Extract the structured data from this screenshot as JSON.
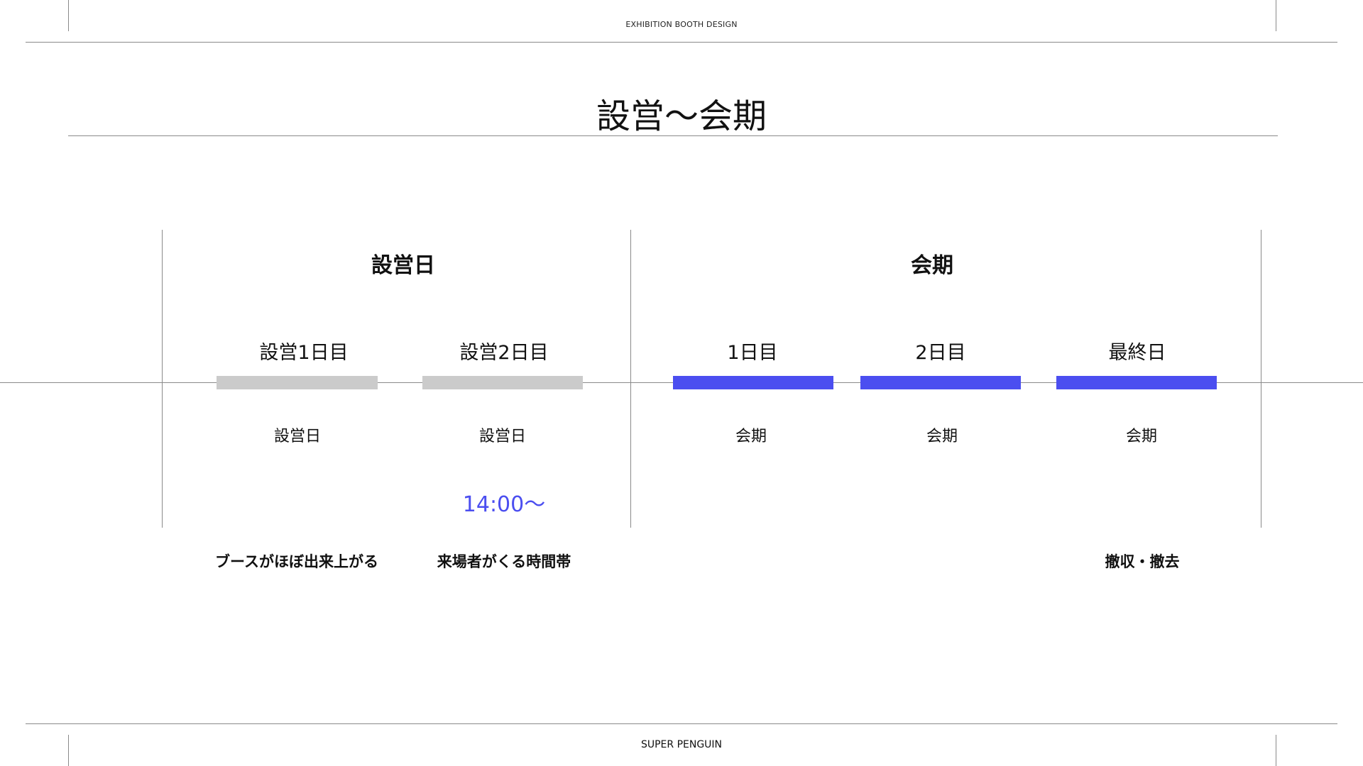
{
  "header": {
    "label": "EXHIBITION BOOTH DESIGN"
  },
  "page": {
    "title": "設営〜会期"
  },
  "footer": {
    "label": "SUPER PENGUIN"
  },
  "timeline": {
    "sections": [
      {
        "title": "設営日"
      },
      {
        "title": "会期"
      }
    ],
    "days": [
      {
        "label": "設営1日目",
        "phase": "設営日",
        "time": "",
        "note": "ブースがほぼ出来上がる",
        "color": "#cbcbcb"
      },
      {
        "label": "設営2日目",
        "phase": "設営日",
        "time": "14:00〜",
        "note": "来場者がくる時間帯",
        "color": "#cbcbcb"
      },
      {
        "label": "1日目",
        "phase": "会期",
        "time": "",
        "note": "",
        "color": "#4b4ef0"
      },
      {
        "label": "2日目",
        "phase": "会期",
        "time": "",
        "note": "",
        "color": "#4b4ef0"
      },
      {
        "label": "最終日",
        "phase": "会期",
        "time": "",
        "note": "撤収・撤去",
        "color": "#4b4ef0"
      }
    ]
  },
  "colors": {
    "accent": "#4b4ef0",
    "setup_bar": "#cbcbcb",
    "rule": "#8a8a8a"
  }
}
